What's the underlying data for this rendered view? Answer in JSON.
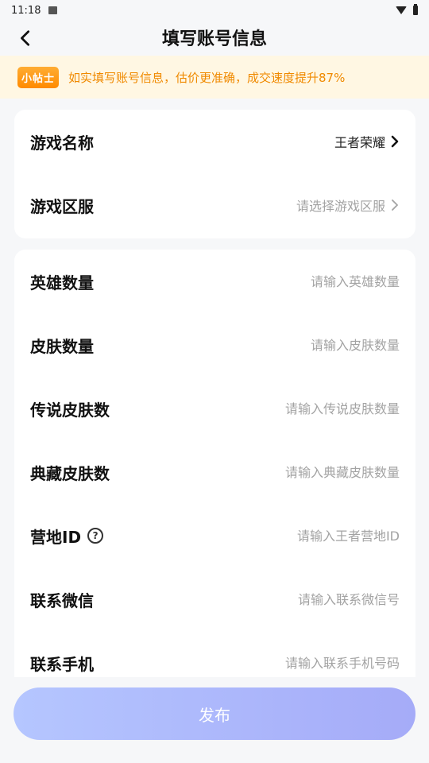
{
  "status": {
    "time": "11:18"
  },
  "header": {
    "title": "填写账号信息"
  },
  "tip": {
    "badge": "小帖士",
    "text": "如实填写账号信息，估价更准确，成交速度提升87%"
  },
  "game_card": {
    "rows": [
      {
        "label": "游戏名称",
        "value": "王者荣耀",
        "state": "selected"
      },
      {
        "label": "游戏区服",
        "value": "请选择游戏区服",
        "state": "placeholder"
      }
    ]
  },
  "form": {
    "hero_count": {
      "label": "英雄数量",
      "placeholder": "请输入英雄数量"
    },
    "skin_count": {
      "label": "皮肤数量",
      "placeholder": "请输入皮肤数量"
    },
    "legend_skin_count": {
      "label": "传说皮肤数",
      "placeholder": "请输入传说皮肤数量"
    },
    "collection_skin_count": {
      "label": "典藏皮肤数",
      "placeholder": "请输入典藏皮肤数量"
    },
    "camp_id": {
      "label": "营地ID",
      "help": "?",
      "placeholder": "请输入王者营地ID"
    },
    "wechat": {
      "label": "联系微信",
      "placeholder": "请输入联系微信号"
    },
    "phone": {
      "label": "联系手机",
      "placeholder": "请输入联系手机号码"
    }
  },
  "actions": {
    "publish_label": "发布"
  },
  "colors": {
    "accent": "#f08a00",
    "button_start": "#b5c6ff",
    "button_end": "#a5abf8"
  }
}
